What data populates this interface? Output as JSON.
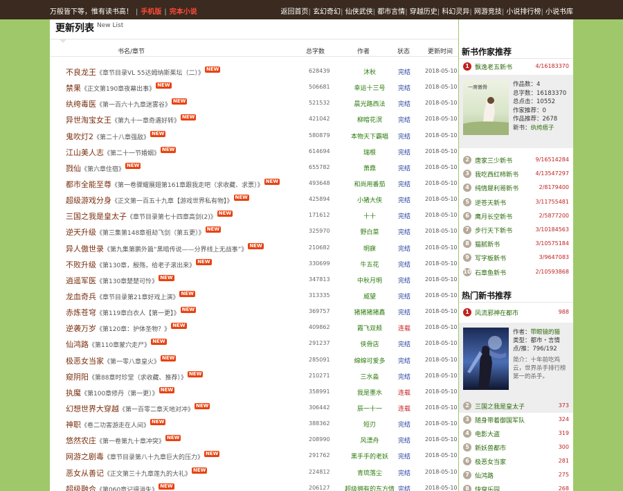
{
  "topbar": {
    "slogan": "万般皆下等，惟有读书高！",
    "links": [
      "手机版",
      "完本小说"
    ],
    "nav": [
      "返回首页",
      "玄幻奇幻",
      "仙侠武侠",
      "都市言情",
      "穿越历史",
      "科幻灵异",
      "网游竞技",
      "小说排行榜",
      "小说书库"
    ]
  },
  "list": {
    "title": "更新列表",
    "subtitle": "New List",
    "columns": {
      "name": "书名/章节",
      "count": "总字数",
      "author": "作者",
      "status": "状态",
      "time": "更新时间"
    },
    "new_tag": "NEW",
    "rows": [
      {
        "name": "不良龙王",
        "chapter": "《章节目录VL 55达姆纳斯茱坛（二）》",
        "count": "628439",
        "author": "沐秋",
        "status": "完结",
        "time": "2018-05-10"
      },
      {
        "name": "禁果",
        "chapter": "《正文第190章夜幕出事》",
        "count": "506681",
        "author": "幸运十三号",
        "status": "完结",
        "time": "2018-05-10"
      },
      {
        "name": "纨绔毒医",
        "chapter": "《第一百六十九章迷雾谷》",
        "count": "521532",
        "author": "晨光路西法",
        "status": "完结",
        "time": "2018-05-10"
      },
      {
        "name": "异世淘宝女王",
        "chapter": "《第九十一章奇遇好转》",
        "count": "421042",
        "author": "柳暗花溟",
        "status": "完结",
        "time": "2018-05-10"
      },
      {
        "name": "鬼吹灯2",
        "chapter": "《第二十八章强敌》",
        "count": "580879",
        "author": "本物天下霸唱",
        "status": "完结",
        "time": "2018-05-10"
      },
      {
        "name": "江山美人志",
        "chapter": "《第二十一节婚姻》",
        "count": "614694",
        "author": "瑞根",
        "status": "完结",
        "time": "2018-05-10"
      },
      {
        "name": "戮仙",
        "chapter": "《第六章住宿》",
        "count": "655782",
        "author": "萧鼎",
        "status": "完结",
        "time": "2018-05-10"
      },
      {
        "name": "都市全能至尊",
        "chapter": "《第一卷骤耀展翅第161章跟我走吧（求收藏、求票）》",
        "count": "493648",
        "author": "和尚用番茄",
        "status": "完结",
        "time": "2018-05-10"
      },
      {
        "name": "超级游戏分身",
        "chapter": "《正文第一百五十九章【游戏世界私有物】》",
        "count": "425894",
        "author": "小猪大侠",
        "status": "完结",
        "time": "2018-05-10"
      },
      {
        "name": "三国之我是皇太子",
        "chapter": "《章节目录第七十四章高剑(2)》",
        "count": "171612",
        "author": "十十",
        "status": "完结",
        "time": "2018-05-10"
      },
      {
        "name": "逆天升级",
        "chapter": "《第三集第148章祖劫飞剑（第五更）》",
        "count": "325970",
        "author": "野白菜",
        "status": "完结",
        "time": "2018-05-10"
      },
      {
        "name": "异人傲世录",
        "chapter": "《第九集第鹏外篇“黑暗传说——分界线上无战事”》",
        "count": "210682",
        "author": "明寐",
        "status": "完结",
        "time": "2018-05-10"
      },
      {
        "name": "不败升级",
        "chapter": "《第130章，殷殇，给老子滚出来》",
        "count": "330699",
        "author": "牛五花",
        "status": "完结",
        "time": "2018-05-10"
      },
      {
        "name": "逍遥军医",
        "chapter": "《第130章楚楚可怜》",
        "count": "347813",
        "author": "中秋月明",
        "status": "完结",
        "time": "2018-05-10"
      },
      {
        "name": "龙血奇兵",
        "chapter": "《章节目录第21章好戏上演》",
        "count": "313335",
        "author": "威望",
        "status": "完结",
        "time": "2018-05-10"
      },
      {
        "name": "赤炼苍穹",
        "chapter": "《第119章白衣人【第一更】》",
        "count": "369757",
        "author": "猪猪猪猪鑫",
        "status": "完结",
        "time": "2018-05-10"
      },
      {
        "name": "逆袭万岁",
        "chapter": "《第120章：护体圣物？》",
        "count": "409862",
        "author": "霞飞双颊",
        "status": "连载",
        "time": "2018-05-10"
      },
      {
        "name": "仙鸿路",
        "chapter": "《第110章蒙穴走尸》",
        "count": "291237",
        "author": "侠骨店",
        "status": "完结",
        "time": "2018-05-10"
      },
      {
        "name": "极恶女当家",
        "chapter": "《第一零八章皇火》",
        "count": "285091",
        "author": "绵绵可爱多",
        "status": "完结",
        "time": "2018-05-10"
      },
      {
        "name": "窥阴阳",
        "chapter": "《第88章时珍堂（求收藏、推荐）》",
        "count": "210271",
        "author": "三水淼",
        "status": "完结",
        "time": "2018-05-10"
      },
      {
        "name": "执魔",
        "chapter": "《第100章修丹（第一更）》",
        "count": "358991",
        "author": "我是墨水",
        "status": "连载",
        "time": "2018-05-10"
      },
      {
        "name": "幻想世界大穿越",
        "chapter": "《第一百零二章天地对冲》",
        "count": "306442",
        "author": "辰一十一",
        "status": "连载",
        "time": "2018-05-10"
      },
      {
        "name": "神职",
        "chapter": "《卷二功害游走在人间》",
        "count": "388362",
        "author": "短刃",
        "status": "完结",
        "time": "2018-05-10"
      },
      {
        "name": "悠然农庄",
        "chapter": "《第一卷第九十章冲突》",
        "count": "208990",
        "author": "风漂舟",
        "status": "完结",
        "time": "2018-05-10"
      },
      {
        "name": "网游之剧毒",
        "chapter": "《章节目录第八十九章巨大的压力》",
        "count": "291762",
        "author": "黑手手的老妖",
        "status": "完结",
        "time": "2018-05-10"
      },
      {
        "name": "恶女从善记",
        "chapter": "《正文第三十九章莲九的大礼》",
        "count": "224812",
        "author": "青琉落尘",
        "status": "完结",
        "time": "2018-05-10"
      },
      {
        "name": "超级融合",
        "chapter": "《第060章记得消失》",
        "count": "206127",
        "author": "超级拥有的东方情",
        "status": "完结",
        "time": "2018-05-10"
      }
    ]
  },
  "author_rank": {
    "title": "新书作家推荐",
    "top": {
      "name": "飘逸老五新书",
      "value": "4/16183370"
    },
    "card": {
      "works": "作品数：4",
      "words": "总字数：16183370",
      "clicks": "总点击：10552",
      "recommend": "作家推荐：0",
      "work_recommend": "作品推荐：2678",
      "newbook_label": "新书：",
      "newbook": "纨绔痞子"
    },
    "items": [
      {
        "n": "2",
        "name": "唐家三少新书",
        "value": "9/16514284"
      },
      {
        "n": "3",
        "name": "我吃西红柿新书",
        "value": "4/13547297"
      },
      {
        "n": "4",
        "name": "纯情犀利哥新书",
        "value": "2/8179400"
      },
      {
        "n": "5",
        "name": "逆苍天新书",
        "value": "3/11755481"
      },
      {
        "n": "6",
        "name": "鹰月长空新书",
        "value": "2/5877200"
      },
      {
        "n": "7",
        "name": "步行天下新书",
        "value": "3/10184563"
      },
      {
        "n": "8",
        "name": "猫腻新书",
        "value": "3/10575184"
      },
      {
        "n": "9",
        "name": "写字板新书",
        "value": "3/9647083"
      },
      {
        "n": "10",
        "name": "石章鱼新书",
        "value": "2/10593868"
      }
    ]
  },
  "hot_rank": {
    "title": "热门新书推荐",
    "top": {
      "name": "风流邪神在都市",
      "value": "988"
    },
    "card": {
      "author_label": "作者：",
      "author": "带眼镜的猫",
      "type_label": "类型：",
      "type": "都市・言情",
      "votes": "点/推：796/192",
      "intro": "简介：十年前吃鸡云，世界杀手排行榜第一的杀手。"
    },
    "items": [
      {
        "n": "2",
        "name": "三国之我是皇太子",
        "value": "373"
      },
      {
        "n": "3",
        "name": "随身带着御国军队",
        "value": "324"
      },
      {
        "n": "4",
        "name": "电影大盗",
        "value": "319"
      },
      {
        "n": "5",
        "name": "新妖兽都市",
        "value": "300"
      },
      {
        "n": "6",
        "name": "极恶女当家",
        "value": "281"
      },
      {
        "n": "7",
        "name": "仙鸿路",
        "value": "275"
      },
      {
        "n": "8",
        "name": "快穿乐园",
        "value": "268"
      }
    ]
  },
  "colors": {
    "bg": "#9ec86a",
    "topbar": "#3a2a1f",
    "accent_red": "#c02020",
    "link_green": "#2b6a0b"
  }
}
